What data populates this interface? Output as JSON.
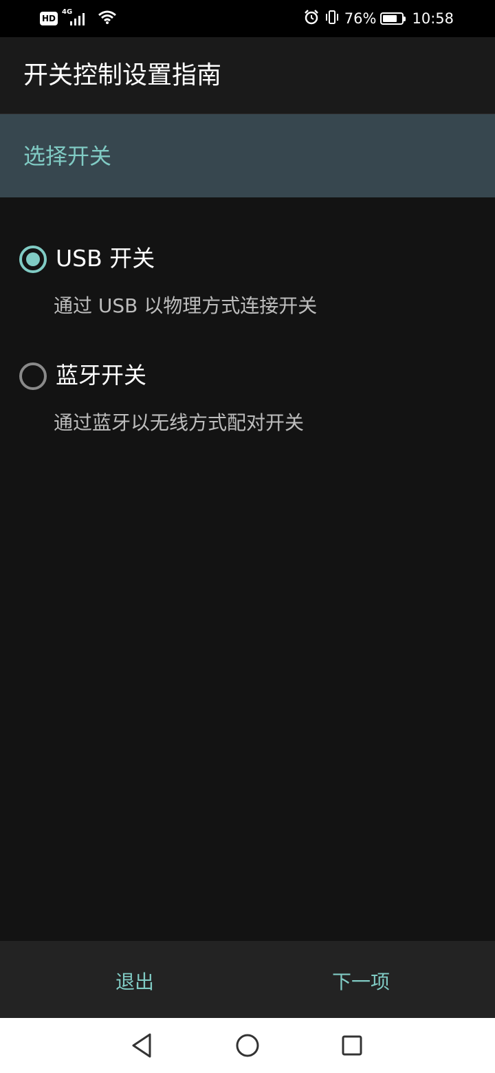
{
  "status_bar": {
    "hd": "HD",
    "network": "4G",
    "battery_percent": "76%",
    "battery_level": 0.76,
    "time": "10:58",
    "icons": [
      "hd-icon",
      "signal-icon",
      "wifi-icon",
      "alarm-icon",
      "vibrate-icon",
      "battery-icon"
    ]
  },
  "app_bar": {
    "title": "开关控制设置指南"
  },
  "section": {
    "title": "选择开关"
  },
  "options": [
    {
      "label": "USB 开关",
      "description": "通过 USB 以物理方式连接开关",
      "selected": true
    },
    {
      "label": "蓝牙开关",
      "description": "通过蓝牙以无线方式配对开关",
      "selected": false
    }
  ],
  "buttons": {
    "exit": "退出",
    "next": "下一项"
  },
  "nav_bar": {
    "icons": [
      "back-triangle-icon",
      "home-circle-icon",
      "recent-square-icon"
    ]
  },
  "colors": {
    "accent": "#80cbc4",
    "section_bg": "#37474f",
    "background": "#131313"
  }
}
